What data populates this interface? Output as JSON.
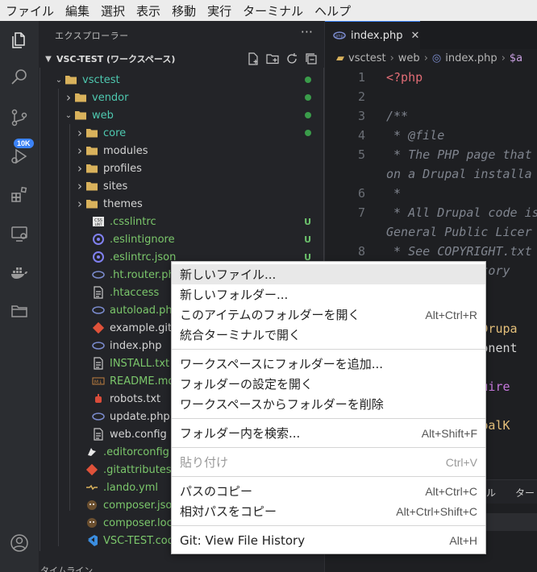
{
  "menubar": [
    "ファイル",
    "編集",
    "選択",
    "表示",
    "移動",
    "実行",
    "ターミナル",
    "ヘルプ"
  ],
  "activity_bar": {
    "items": [
      "explorer-icon",
      "search-icon",
      "source-control-icon",
      "run-debug-icon",
      "extensions-icon",
      "remote-explorer-icon",
      "docker-icon",
      "folder-icon"
    ],
    "scm_badge": "10K",
    "account": "account-icon"
  },
  "sidebar": {
    "title": "エクスプローラー",
    "more": "···",
    "workspace_title": "VSC-TEST (ワークスペース)",
    "tree": [
      {
        "label": "vsctest",
        "depth": 0,
        "twisty": "down",
        "icon": "folder-icon",
        "color": "teal",
        "status": "dot"
      },
      {
        "label": "vendor",
        "depth": 1,
        "twisty": "right",
        "icon": "folder-icon",
        "color": "teal",
        "status": "dot"
      },
      {
        "label": "web",
        "depth": 1,
        "twisty": "down",
        "icon": "folder-icon",
        "color": "teal",
        "status": "dot"
      },
      {
        "label": "core",
        "depth": 2,
        "twisty": "right",
        "icon": "folder-icon",
        "color": "teal",
        "status": "dot"
      },
      {
        "label": "modules",
        "depth": 2,
        "twisty": "right",
        "icon": "folder-icon",
        "color": "plain",
        "status": ""
      },
      {
        "label": "profiles",
        "depth": 2,
        "twisty": "right",
        "icon": "folder-icon",
        "color": "plain",
        "status": ""
      },
      {
        "label": "sites",
        "depth": 2,
        "twisty": "right",
        "icon": "folder-icon",
        "color": "plain",
        "status": ""
      },
      {
        "label": "themes",
        "depth": 2,
        "twisty": "right",
        "icon": "folder-icon",
        "color": "plain",
        "status": ""
      },
      {
        "label": ".csslintrc",
        "depth": 3,
        "twisty": "",
        "icon": "css-file-icon",
        "color": "green",
        "status": "U"
      },
      {
        "label": ".eslintignore",
        "depth": 3,
        "twisty": "",
        "icon": "eslint-file-icon",
        "color": "green",
        "status": "U"
      },
      {
        "label": ".eslintrc.json",
        "depth": 3,
        "twisty": "",
        "icon": "eslint-file-icon",
        "color": "green",
        "status": "U"
      },
      {
        "label": ".ht.router.php",
        "depth": 3,
        "twisty": "",
        "icon": "php-file-icon",
        "color": "green",
        "status": ""
      },
      {
        "label": ".htaccess",
        "depth": 3,
        "twisty": "",
        "icon": "text-file-icon",
        "color": "green",
        "status": ""
      },
      {
        "label": "autoload.php",
        "depth": 3,
        "twisty": "",
        "icon": "php-file-icon",
        "color": "green",
        "status": ""
      },
      {
        "label": "example.gitigno",
        "depth": 3,
        "twisty": "",
        "icon": "git-file-icon",
        "color": "plain",
        "status": ""
      },
      {
        "label": "index.php",
        "depth": 3,
        "twisty": "",
        "icon": "php-file-icon",
        "color": "plain",
        "status": ""
      },
      {
        "label": "INSTALL.txt",
        "depth": 3,
        "twisty": "",
        "icon": "text-file-icon",
        "color": "green",
        "status": ""
      },
      {
        "label": "README.md",
        "depth": 3,
        "twisty": "",
        "icon": "markdown-file-icon",
        "color": "green",
        "status": ""
      },
      {
        "label": "robots.txt",
        "depth": 3,
        "twisty": "",
        "icon": "robot-file-icon",
        "color": "plain",
        "status": ""
      },
      {
        "label": "update.php",
        "depth": 3,
        "twisty": "",
        "icon": "php-file-icon",
        "color": "plain",
        "status": ""
      },
      {
        "label": "web.config",
        "depth": 3,
        "twisty": "",
        "icon": "text-file-icon",
        "color": "plain",
        "status": ""
      },
      {
        "label": ".editorconfig",
        "depth": 2,
        "twisty": "",
        "icon": "editorconfig-file-icon",
        "color": "green",
        "status": ""
      },
      {
        "label": ".gitattributes",
        "depth": 2,
        "twisty": "",
        "icon": "git-file-icon",
        "color": "green",
        "status": ""
      },
      {
        "label": ".lando.yml",
        "depth": 2,
        "twisty": "",
        "icon": "yaml-file-icon",
        "color": "green",
        "status": ""
      },
      {
        "label": "composer.json",
        "depth": 2,
        "twisty": "",
        "icon": "composer-file-icon",
        "color": "green",
        "status": ""
      },
      {
        "label": "composer.lock",
        "depth": 2,
        "twisty": "",
        "icon": "composer-file-icon",
        "color": "green",
        "status": ""
      },
      {
        "label": "VSC-TEST.code-w",
        "depth": 2,
        "twisty": "",
        "icon": "vscode-file-icon",
        "color": "green",
        "status": ""
      }
    ]
  },
  "editor": {
    "tab": "index.php",
    "breadcrumbs": [
      "vsctest",
      "web",
      "index.php",
      "$a"
    ],
    "lines": [
      {
        "n": "1",
        "parts": [
          [
            "kw",
            "<?php"
          ]
        ]
      },
      {
        "n": "2",
        "parts": []
      },
      {
        "n": "3",
        "parts": [
          [
            "cm",
            "/**"
          ]
        ]
      },
      {
        "n": "4",
        "parts": [
          [
            "cm",
            " * @file"
          ]
        ]
      },
      {
        "n": "5",
        "parts": [
          [
            "cm",
            " * The PHP page that"
          ]
        ]
      },
      {
        "n": "",
        "parts": [
          [
            "cm",
            "on a Drupal installa"
          ]
        ]
      },
      {
        "n": "6",
        "parts": [
          [
            "cm",
            " *"
          ]
        ]
      },
      {
        "n": "7",
        "parts": [
          [
            "cm",
            " * All Drupal code is"
          ]
        ]
      },
      {
        "n": "",
        "parts": [
          [
            "cm",
            "General Public Licer"
          ]
        ]
      },
      {
        "n": "8",
        "parts": [
          [
            "cm",
            " * See COPYRIGHT.txt"
          ]
        ]
      },
      {
        "n": "",
        "parts": [
          [
            "cm",
            "          rectory"
          ]
        ]
      },
      {
        "n": "",
        "parts": []
      },
      {
        "n": "",
        "parts": []
      },
      {
        "n": "",
        "parts": [
          [
            "plain",
            "          re\\"
          ],
          [
            "ty",
            "Drupa"
          ]
        ]
      },
      {
        "n": "",
        "parts": [
          [
            "plain",
            "          omponent"
          ]
        ]
      },
      {
        "n": "",
        "parts": []
      },
      {
        "n": "",
        "parts": [
          [
            "pur",
            "          require"
          ]
        ]
      },
      {
        "n": "",
        "parts": []
      },
      {
        "n": "",
        "parts": [
          [
            "ty",
            "          DrupalK"
          ]
        ]
      }
    ],
    "panel_tabs": [
      "ル",
      "ター"
    ]
  },
  "bottom_section": "タイムライン",
  "context_menu": {
    "items": [
      {
        "label": "新しいファイル...",
        "shortcut": "",
        "highlight": true
      },
      {
        "label": "新しいフォルダー...",
        "shortcut": ""
      },
      {
        "label": "このアイテムのフォルダーを開く",
        "shortcut": "Alt+Ctrl+R"
      },
      {
        "label": "統合ターミナルで開く",
        "shortcut": ""
      },
      {
        "sep": true
      },
      {
        "label": "ワークスペースにフォルダーを追加...",
        "shortcut": ""
      },
      {
        "label": "フォルダーの設定を開く",
        "shortcut": ""
      },
      {
        "label": "ワークスペースからフォルダーを削除",
        "shortcut": ""
      },
      {
        "sep": true
      },
      {
        "label": "フォルダー内を検索...",
        "shortcut": "Alt+Shift+F"
      },
      {
        "sep": true
      },
      {
        "label": "貼り付け",
        "shortcut": "Ctrl+V",
        "disabled": true
      },
      {
        "sep": true
      },
      {
        "label": "パスのコピー",
        "shortcut": "Alt+Ctrl+C"
      },
      {
        "label": "相対パスをコピー",
        "shortcut": "Alt+Ctrl+Shift+C"
      },
      {
        "sep": true
      },
      {
        "label": "Git: View File History",
        "shortcut": "Alt+H"
      }
    ]
  }
}
